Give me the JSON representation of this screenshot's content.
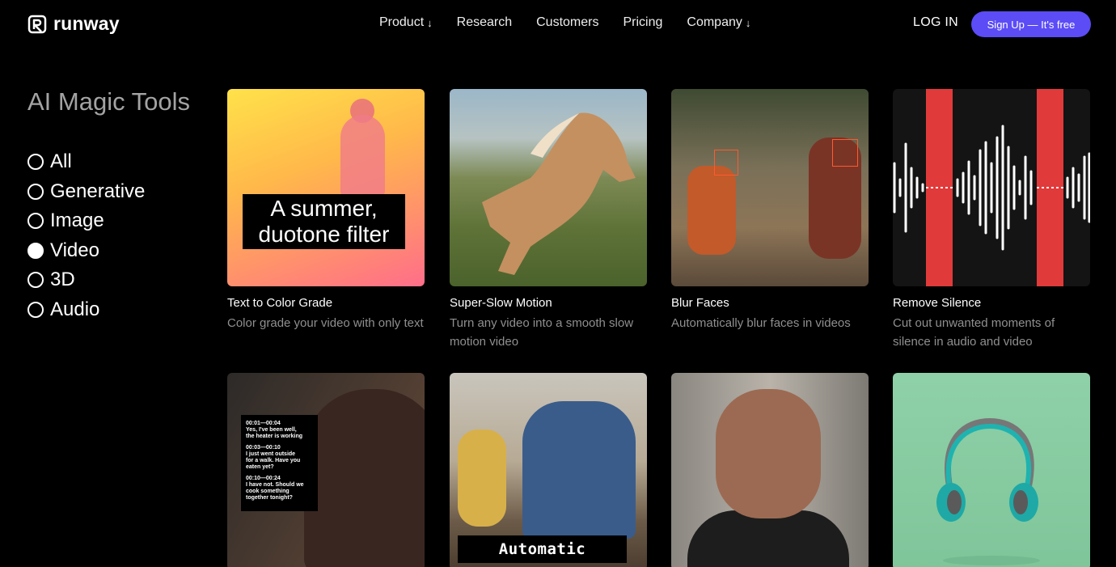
{
  "header": {
    "logo_text": "runway",
    "nav": [
      {
        "label": "Product",
        "arrow": "↓"
      },
      {
        "label": "Research",
        "arrow": ""
      },
      {
        "label": "Customers",
        "arrow": ""
      },
      {
        "label": "Pricing",
        "arrow": ""
      },
      {
        "label": "Company",
        "arrow": "↓"
      }
    ],
    "login": "LOG IN",
    "signup": "Sign Up — It's free"
  },
  "sidebar": {
    "title": "AI Magic Tools",
    "filters": [
      {
        "label": "All",
        "checked": false
      },
      {
        "label": "Generative",
        "checked": false
      },
      {
        "label": "Image",
        "checked": false
      },
      {
        "label": "Video",
        "checked": true
      },
      {
        "label": "3D",
        "checked": false
      },
      {
        "label": "Audio",
        "checked": false
      }
    ]
  },
  "cards": [
    {
      "title": "Text to Color Grade",
      "description": "Color grade your video with only text",
      "overlay": "A summer, duotone filter"
    },
    {
      "title": "Super-Slow Motion",
      "description": "Turn any video into a smooth slow motion video"
    },
    {
      "title": "Blur Faces",
      "description": "Automatically blur faces in videos"
    },
    {
      "title": "Remove Silence",
      "description": "Cut out unwanted moments of silence in audio and video"
    },
    {
      "title": "",
      "description": "",
      "subtitles": [
        "00:01—00:04\nYes, I've been well,\nthe heater is working",
        "00:03—00:10\nI just went outside\nfor a walk. Have you\neaten yet?",
        "00:10—00:24\nI have not. Should we\ncook something\ntogether tonight?"
      ]
    },
    {
      "title": "",
      "description": "",
      "overlay": "Automatic subtitles"
    },
    {
      "title": "",
      "description": ""
    },
    {
      "title": "",
      "description": ""
    }
  ],
  "colors": {
    "accent": "#5b4cf6",
    "silence_red": "#e13a3a",
    "face_box": "#ff5a2e"
  }
}
